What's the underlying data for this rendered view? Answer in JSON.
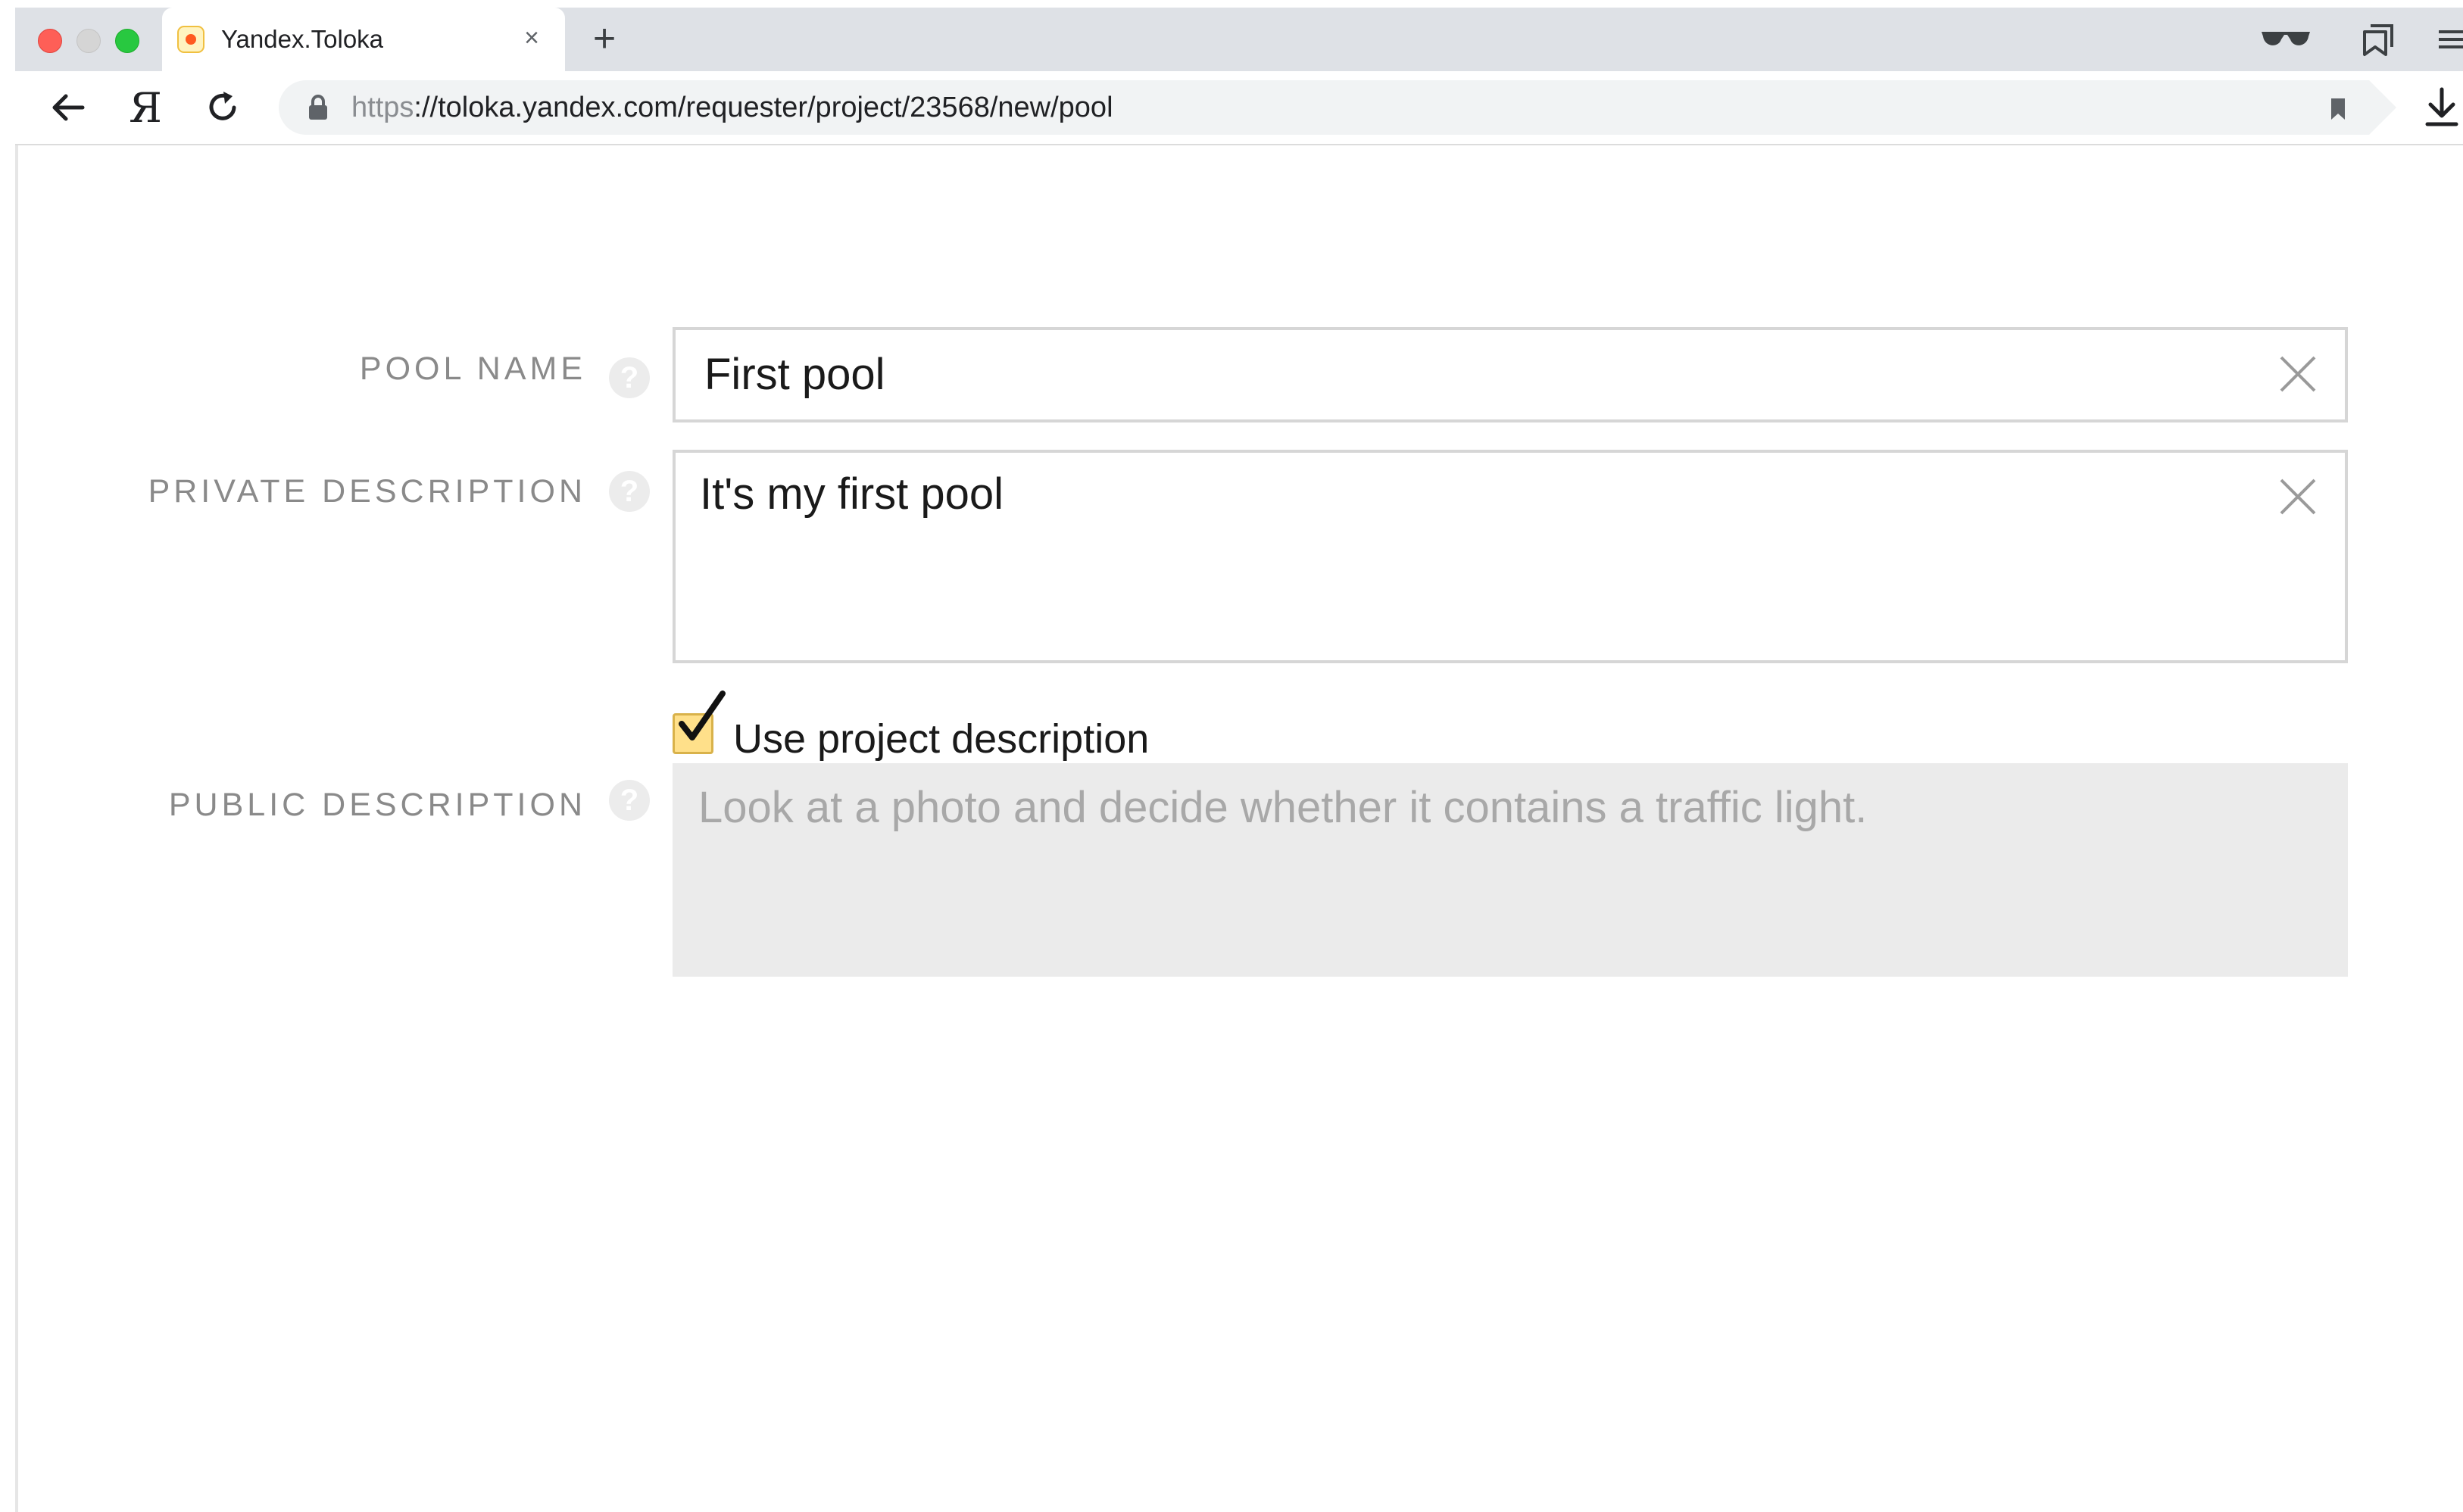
{
  "browser": {
    "tab": {
      "title": "Yandex.Toloka",
      "close_glyph": "×",
      "favicon": "toloka-favicon"
    },
    "new_tab_glyph": "+",
    "yandex_button_glyph": "Я",
    "address": {
      "scheme": "https",
      "rest": "://toloka.yandex.com/requester/project/23568/new/pool"
    },
    "icons": [
      "back-arrow-icon",
      "reload-icon",
      "lock-icon",
      "bookmark-icon",
      "download-icon",
      "glasses-icon",
      "collections-icon",
      "menu-icon"
    ]
  },
  "form": {
    "pool_name": {
      "label": "POOL NAME",
      "value": "First pool",
      "help": "?"
    },
    "private_description": {
      "label": "PRIVATE DESCRIPTION",
      "value": "It's my first pool",
      "help": "?"
    },
    "use_project_description": {
      "label": "Use project description",
      "checked": true
    },
    "public_description": {
      "label": "PUBLIC DESCRIPTION",
      "help": "?",
      "value": "Look at a photo and decide whether it contains a traffic light."
    }
  },
  "colors": {
    "checkbox_fill": "#ffe08a",
    "label_text": "#8a8a8a",
    "disabled_field": "#ebebeb"
  }
}
